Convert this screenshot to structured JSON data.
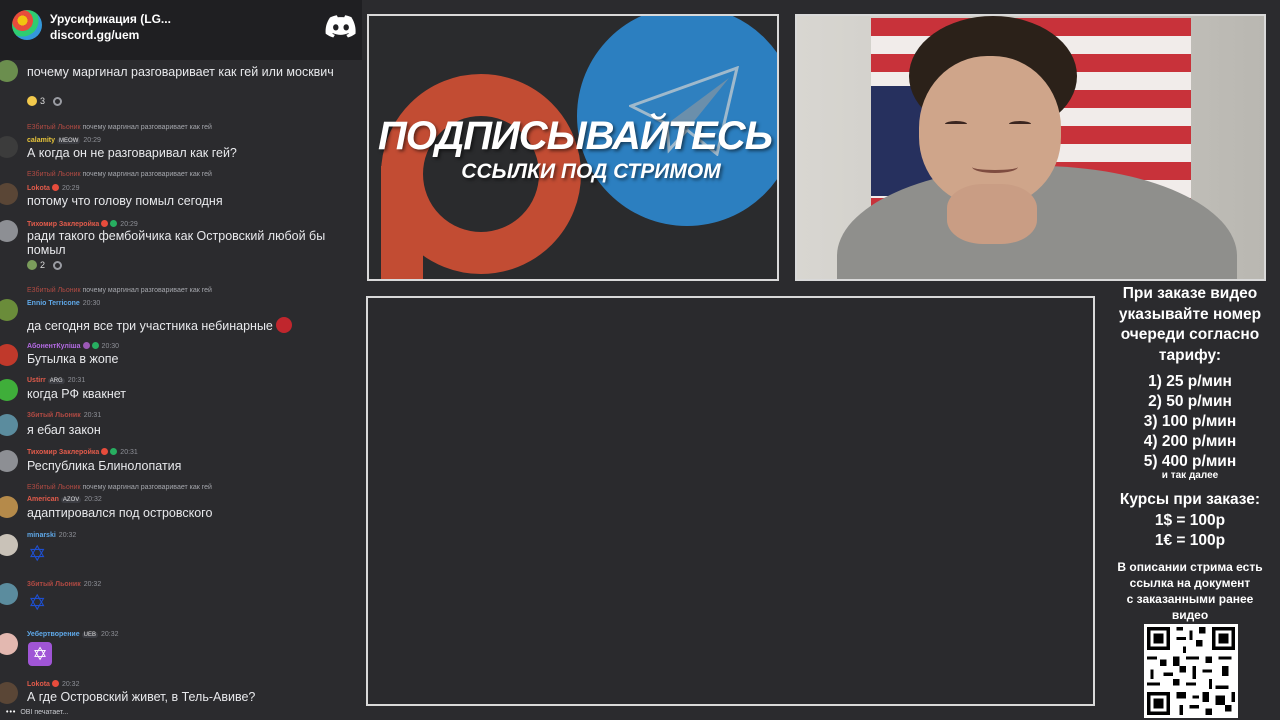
{
  "server": {
    "name": "Урусификация (LG...",
    "link": "discord.gg/uem"
  },
  "colors": {
    "background": "#2b2b2e",
    "panel_border": "#d9d9d9",
    "telegram_blue": "#2c7fc0",
    "patreon_red": "#c24c33"
  },
  "messages": [
    {
      "text": "почему маргинал разговаривает как гей или москвич",
      "reactions": [
        "3"
      ]
    },
    {
      "reply_name": "Е3битый Льоник",
      "reply_text": "почему маргинал разговаривает как гей",
      "user": "calamity",
      "badge": "MEOW",
      "time": "20:29",
      "text": "А когда он не разговаривал как гей?"
    },
    {
      "reply_name": "Е3битый Льоник",
      "reply_text": "почему маргинал разговаривает как гей",
      "user": "Lokota",
      "time": "20:29",
      "text": "потому что голову помыл сегодня"
    },
    {
      "user": "Тихомир Заклеройка",
      "time": "20:29",
      "text": "ради такого фембойчика как Островский любой бы помыл",
      "reactions": [
        "2"
      ]
    },
    {
      "reply_name": "Е3битый Льоник",
      "reply_text": "почему маргинал разговаривает как гей",
      "user": "Ennio Terricone",
      "time": "20:30",
      "text": "да сегодня все три участника небинарные"
    },
    {
      "user": "АбонентКуліша",
      "time": "20:30",
      "text": "Бутылка в жопе"
    },
    {
      "user": "Ustirr",
      "badge": "ARG",
      "time": "20:31",
      "text": "когда РФ квакнет"
    },
    {
      "user": "3битый Льоник",
      "time": "20:31",
      "text": "я ебал закон"
    },
    {
      "user": "Тихомир Заклеройка",
      "time": "20:31",
      "text": "Республика Блинолопатия"
    },
    {
      "reply_name": "Е3битый Льоник",
      "reply_text": "почему маргинал разговаривает как гей",
      "user": "American",
      "badge": "AZOV",
      "time": "20:32",
      "text": "адаптировался под островского"
    },
    {
      "user": "minarski",
      "time": "20:32",
      "text": "✡"
    },
    {
      "user": "3битый Льоник",
      "time": "20:32",
      "text": "✡"
    },
    {
      "user": "Уебертворение",
      "badge": "UEB",
      "time": "20:32",
      "text": "✡"
    },
    {
      "user": "Lokota",
      "time": "20:32",
      "text": "А где Островский живет, в Тель-Авиве?"
    }
  ],
  "typing": "OBI печатает...",
  "banner": {
    "title": "ПОДПИСЫВАЙТЕСЬ",
    "subtitle": "ССЫЛКИ ПОД СТРИМОМ"
  },
  "info": {
    "heading_lines": [
      "При заказе видео",
      "указывайте номер",
      "очереди согласно",
      "тарифу:"
    ],
    "tariffs": [
      "1) 25 р/мин",
      "2) 50 р/мин",
      "3) 100 р/мин",
      "4) 200 р/мин",
      "5) 400 р/мин"
    ],
    "tariff_more": "и так далее",
    "rates_title": "Курсы при заказе:",
    "rates": [
      "1$ = 100р",
      "1€ = 100р"
    ],
    "doc_lines": [
      "В описании стрима есть",
      "ссылка на документ",
      "с заказанными ранее",
      "видео"
    ]
  }
}
